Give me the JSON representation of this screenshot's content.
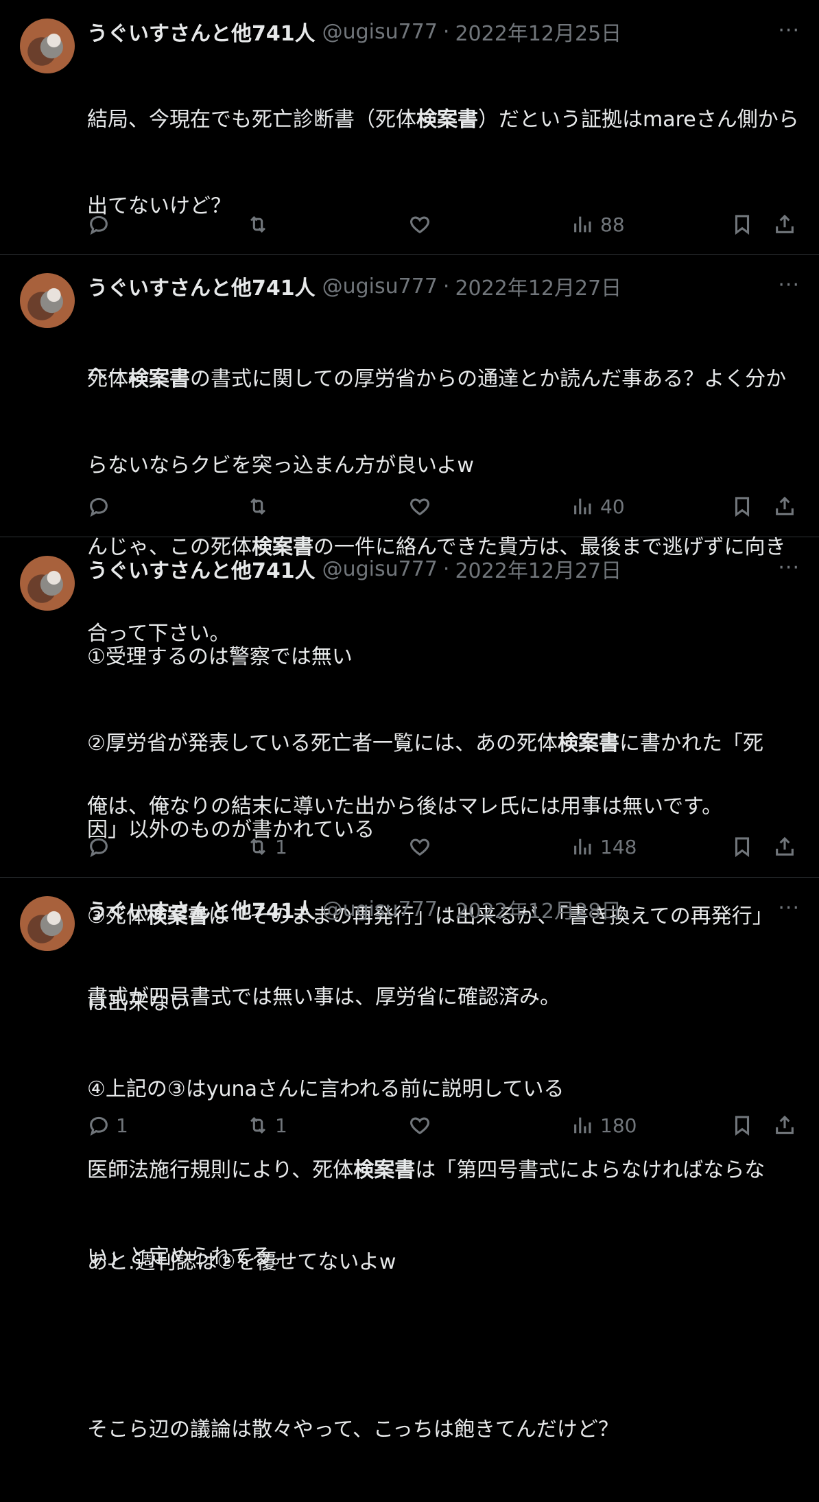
{
  "tweets": [
    {
      "display_name": "うぐいすさんと他741人",
      "handle": "@ugisu777",
      "separator": "·",
      "date": "2022年12月25日",
      "more": "···",
      "lines": [
        "結局、今現在でも死亡診断書（死体検案書）だという証拠はmareさん側から",
        "出てないけど？",
        "",
        "死体検案書の書式に関しての厚労省からの通達とか読んだ事ある？よく分か",
        "らないならクビを突っ込まん方が良いよw"
      ],
      "replies": "",
      "retweets": "",
      "likes": "",
      "views": "88"
    },
    {
      "display_name": "うぐいすさんと他741人",
      "handle": "@ugisu777",
      "separator": "·",
      "date": "2022年12月27日",
      "more": "···",
      "lines": [
        "へー。",
        "",
        "んじゃ、この死体検案書の一件に絡んできた貴方は、最後まで逃げずに向き",
        "合って下さい。",
        "",
        "俺は、俺なりの結末に導いた出から後はマレ氏には用事は無いです。"
      ],
      "replies": "",
      "retweets": "",
      "likes": "",
      "views": "40"
    },
    {
      "display_name": "うぐいすさんと他741人",
      "handle": "@ugisu777",
      "separator": "·",
      "date": "2022年12月27日",
      "more": "···",
      "lines": [
        "①受理するのは警察では無い",
        "②厚労省が発表している死亡者一覧には、あの死体検案書に書かれた「死",
        "因」以外のものが書かれている",
        "③死体検案書は「そのままの再発行」は出来るが、「書き換えての再発行」",
        "は出来ない",
        "④上記の③はyunaさんに言われる前に説明している",
        "",
        "あと.週刊誌は②を覆せてないよw"
      ],
      "replies": "",
      "retweets": "1",
      "likes": "",
      "views": "148"
    },
    {
      "display_name": "うぐいすさんと他741人",
      "handle": "@ugisu777",
      "separator": "·",
      "date": "2022年12月28日",
      "more": "···",
      "lines": [
        "書式が四号書式では無い事は、厚労省に確認済み。",
        "",
        "医師法施行規則により、死体検案書は「第四号書式によらなければならな",
        "い」と定められてる。",
        "",
        "そこら辺の議論は散々やって、こっちは飽きてんだけど？"
      ],
      "replies": "1",
      "retweets": "1",
      "likes": "",
      "views": "180"
    }
  ],
  "highlight_term": "検案書",
  "colors": {
    "background": "#000000",
    "text": "#e7e9ea",
    "muted": "#71767b",
    "divider": "#2f3336"
  },
  "icons": [
    "reply-icon",
    "retweet-icon",
    "like-icon",
    "views-icon",
    "bookmark-icon",
    "share-icon",
    "more-icon"
  ]
}
